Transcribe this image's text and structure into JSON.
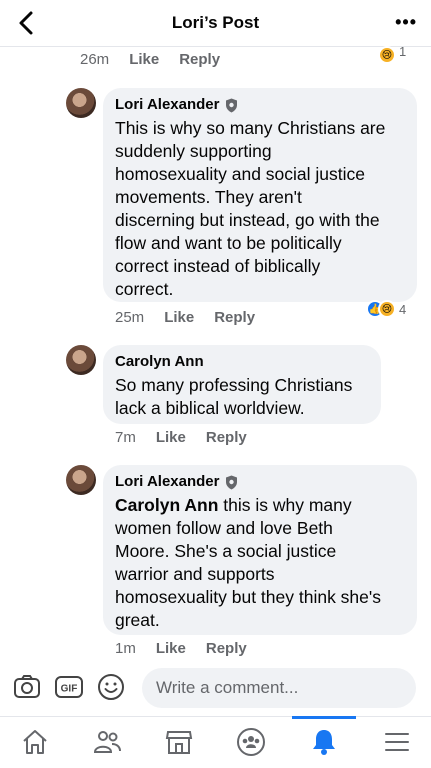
{
  "header": {
    "title": "Lori’s Post",
    "more": "•••"
  },
  "prev_actions": {
    "time": "26m",
    "like": "Like",
    "reply": "Reply",
    "reaction_count": "1"
  },
  "comments": [
    {
      "author": "Lori Alexander",
      "lines": [
        "This is why so many Christians are",
        "suddenly supporting",
        "homosexuality and social justice",
        "movements. They aren't",
        "discerning but instead, go with the",
        "flow and want to be politically",
        "correct instead of biblically",
        "correct."
      ],
      "time": "25m",
      "like": "Like",
      "reply": "Reply",
      "reaction_count": "4"
    },
    {
      "author": "Carolyn Ann",
      "lines": [
        "So many professing Christians",
        "lack a biblical worldview."
      ],
      "time": "7m",
      "like": "Like",
      "reply": "Reply"
    },
    {
      "author": "Lori Alexander",
      "mention": "Carolyn Ann",
      "lines": [
        " this is why many",
        "women follow and love Beth",
        "Moore. She's a social justice",
        "warrior and supports",
        "homosexuality but they think she's",
        "great."
      ],
      "time": "1m",
      "like": "Like",
      "reply": "Reply"
    }
  ],
  "composer": {
    "placeholder": "Write a comment..."
  },
  "icons": [
    "back-icon",
    "more-icon",
    "camera-icon",
    "gif-icon",
    "emoji-icon",
    "home-icon",
    "friends-icon",
    "marketplace-icon",
    "groups-icon",
    "notifications-icon",
    "menu-icon"
  ],
  "colors": {
    "accent": "#1877f2",
    "bubble": "#f0f2f5",
    "meta": "#65676b"
  }
}
